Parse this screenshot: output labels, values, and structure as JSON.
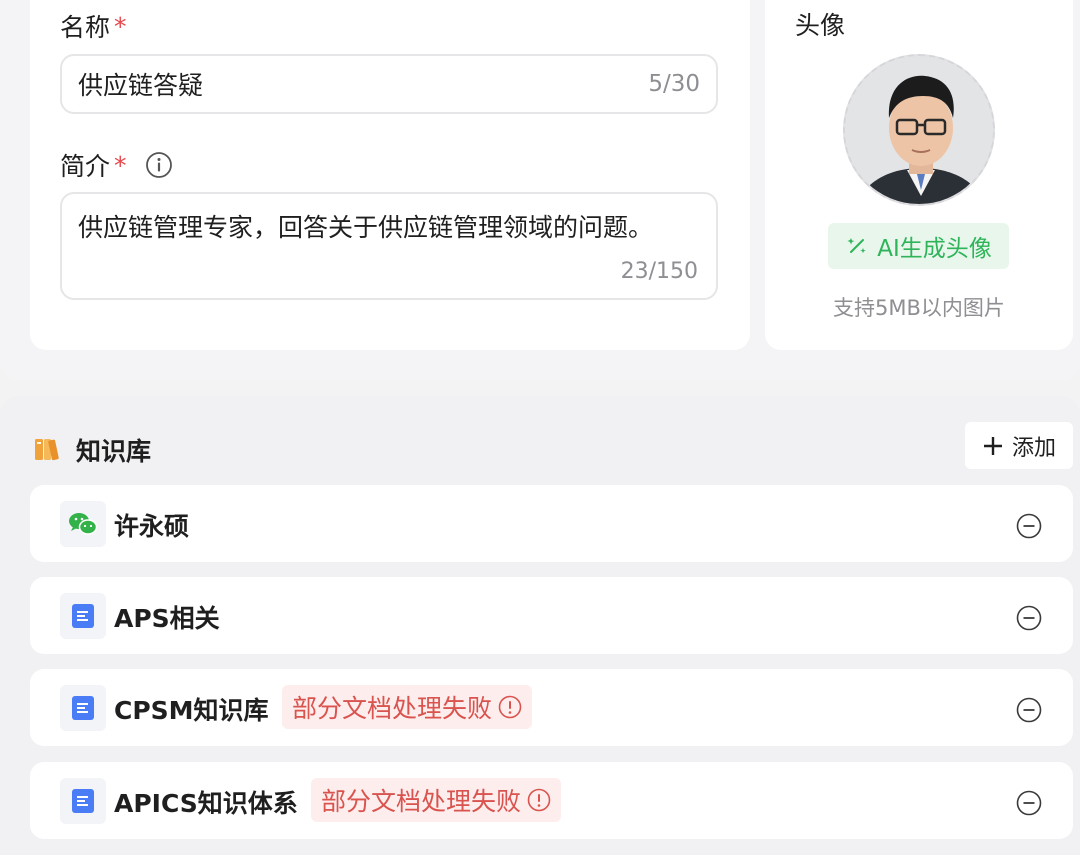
{
  "basic": {
    "name_label": "名称",
    "required_mark": "*",
    "name_value": "供应链答疑",
    "name_counter": "5/30",
    "desc_label": "简介",
    "desc_value": "供应链管理专家，回答关于供应链管理领域的问题。",
    "desc_counter": "23/150"
  },
  "avatar": {
    "title": "头像",
    "ai_button_label": "AI生成头像",
    "hint": "支持5MB以内图片"
  },
  "knowledge": {
    "title": "知识库",
    "add_label": "添加",
    "items": [
      {
        "name": "许永硕",
        "icon": "wechat-icon",
        "status": ""
      },
      {
        "name": "APS相关",
        "icon": "document-icon",
        "status": ""
      },
      {
        "name": "CPSM知识库",
        "icon": "document-icon",
        "status": "部分文档处理失败"
      },
      {
        "name": "APICS知识体系",
        "icon": "document-icon",
        "status": "部分文档处理失败"
      }
    ]
  },
  "colors": {
    "required": "#e5484d",
    "ai_green": "#2fb45a",
    "fail_red": "#d9534f",
    "doc_blue": "#4a7cf6"
  }
}
